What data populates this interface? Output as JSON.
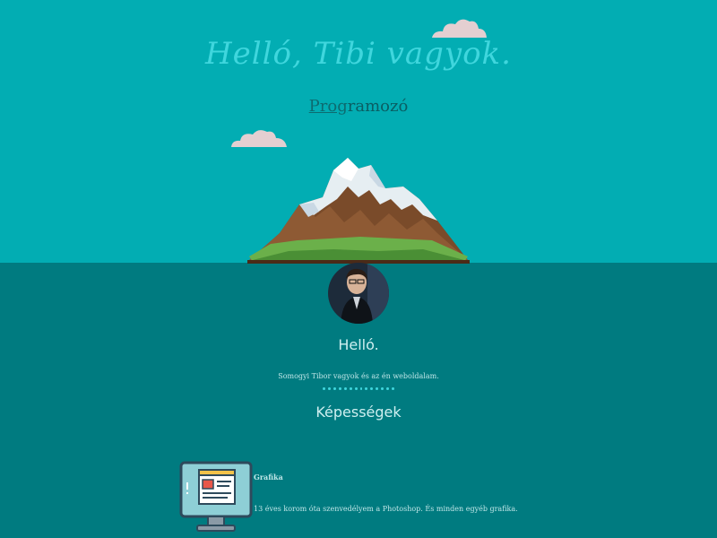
{
  "hero": {
    "title": "Helló, Tibi vagyok.",
    "subtitle_underlined": "Prog",
    "subtitle_rest": "ramozó"
  },
  "about": {
    "greeting": "Helló.",
    "intro": "Somogyi Tibor vagyok és az én weboldalam."
  },
  "skills": {
    "title": "Képességek",
    "items": [
      {
        "name": "Grafika",
        "description": "13 éves korom óta szenvedélyem a Photoshop. És minden egyéb grafika.",
        "icon": "monitor-icon"
      }
    ]
  },
  "colors": {
    "sky": "#02adb3",
    "sea": "#007b80",
    "accent": "#3fd6dd"
  }
}
